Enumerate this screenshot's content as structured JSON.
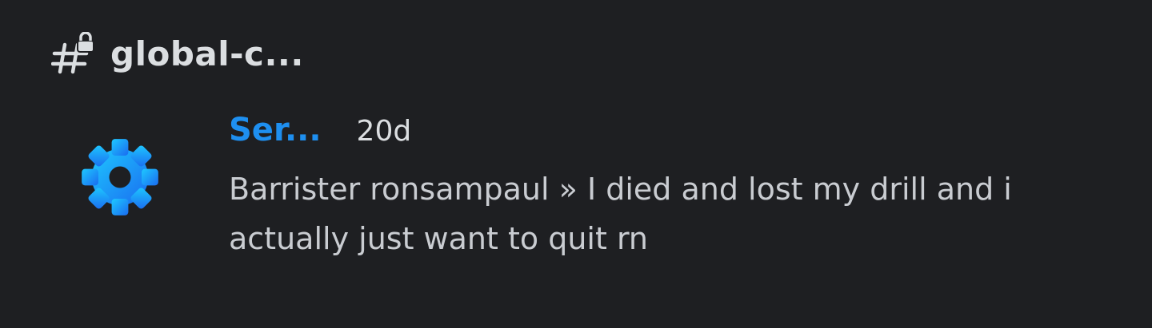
{
  "channel": {
    "icon": "locked-text-channel-icon",
    "name": "global-c..."
  },
  "message": {
    "avatar_icon": "gear-icon",
    "author": "Ser...",
    "timestamp": "20d",
    "content": "Barrister ronsampaul » I died and lost my drill and i actually just want to quit rn"
  },
  "colors": {
    "background": "#1e1f22",
    "author": "#1e8ff0",
    "text": "#dbdee1",
    "gear_gradient_start": "#1ec8ff",
    "gear_gradient_end": "#1a6cf0"
  }
}
